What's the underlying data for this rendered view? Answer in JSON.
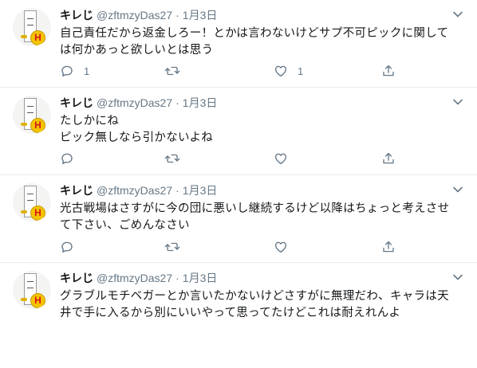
{
  "tweets": [
    {
      "display_name": "キレじ",
      "handle": "@zftmzyDas27",
      "separator": "·",
      "date": "1月3日",
      "lines": [
        "自己責任だから返金しろー！とかは言わないけどサプ不可ピックに関して",
        "は何かあっと欲しいとは思う"
      ],
      "reply_count": "1",
      "retweet_count": "",
      "like_count": "1",
      "avatar_badge": "H"
    },
    {
      "display_name": "キレじ",
      "handle": "@zftmzyDas27",
      "separator": "·",
      "date": "1月3日",
      "lines": [
        "たしかにね",
        "ピック無しなら引かないよね"
      ],
      "reply_count": "",
      "retweet_count": "",
      "like_count": "",
      "avatar_badge": "H"
    },
    {
      "display_name": "キレじ",
      "handle": "@zftmzyDas27",
      "separator": "·",
      "date": "1月3日",
      "lines": [
        "光古戦場はさすがに今の団に悪いし継続するけど以降はちょっと考えさせ",
        "て下さい、ごめんなさい"
      ],
      "reply_count": "",
      "retweet_count": "",
      "like_count": "",
      "avatar_badge": "H"
    },
    {
      "display_name": "キレじ",
      "handle": "@zftmzyDas27",
      "separator": "·",
      "date": "1月3日",
      "lines": [
        "グラブルモチベガーとか言いたかないけどさすがに無理だわ、キャラは天",
        "井で手に入るから別にいいやって思ってたけどこれは耐えれんよ"
      ],
      "reply_count": "",
      "retweet_count": "",
      "like_count": "",
      "avatar_badge": "H"
    }
  ],
  "icons": [
    "reply-icon",
    "retweet-icon",
    "like-icon",
    "share-icon",
    "caret-down-icon"
  ],
  "colors": {
    "text": "#14171a",
    "muted": "#657786",
    "divider": "#e6ecf0",
    "background": "#ffffff"
  }
}
